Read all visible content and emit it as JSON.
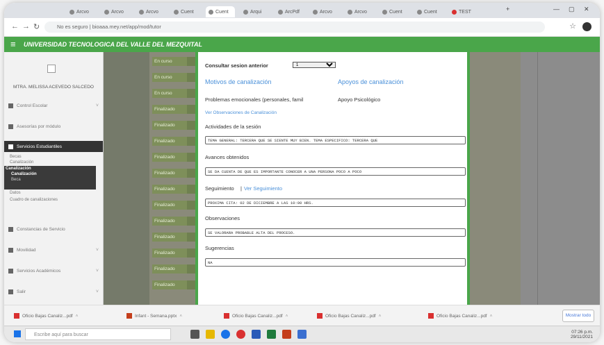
{
  "browser": {
    "tabs": [
      "Arcvo",
      "Arcvo",
      "Arcvo",
      "Cuent",
      "Cuent",
      "Arqui",
      "ArcPdf",
      "Arcvo",
      "Arcvo",
      "Cuent",
      "Cuent",
      "TEST"
    ],
    "active_tab": "4",
    "url": "No es seguro | bioaaa.mey.net/app/mod/tutor"
  },
  "app": {
    "title": "UNIVERSIDAD TECNOLOGICA DEL VALLE DEL MEZQUITAL"
  },
  "sidebar": {
    "user_name": "MTRA. MELISSA ACEVEDO SALCEDO",
    "items": [
      {
        "label": "Control Escolar",
        "icon": "book-icon"
      },
      {
        "label": "Asesorías por módulo",
        "icon": "grid-icon"
      },
      {
        "label": "Servicios Estudiantiles",
        "icon": "users-icon"
      },
      {
        "label": "Constancias de Servicio",
        "icon": "monitor-icon"
      },
      {
        "label": "Movilidad",
        "icon": "chart-icon"
      },
      {
        "label": "Servicios Académicos",
        "icon": "settings-icon"
      },
      {
        "label": "Salir",
        "icon": "exit-icon"
      }
    ],
    "subitems": [
      "Becas",
      "Canalización"
    ],
    "highlight_lines": [
      "Canalización",
      "Canalización",
      "Beca",
      "Datos",
      "Cuadro de canalizaciones"
    ]
  },
  "background_rows": [
    "En curso",
    "En curso",
    "En curso",
    "Finalizado",
    "Finalizado",
    "Finalizado",
    "Finalizado",
    "Finalizado",
    "Finalizado",
    "Finalizado",
    "Finalizado",
    "Finalizado",
    "Finalizado",
    "Finalizado",
    "Finalizado"
  ],
  "modal": {
    "consult_label": "Consultar sesion anterior",
    "consult_value": "1",
    "motivos_header": "Motivos de canalización",
    "apoyos_header": "Apoyos de canalización",
    "motivo_value": "Problemas emocionales (personales, famil",
    "apoyo_value": "Apoyo Psicológico",
    "ver_observaciones": "Ver Observaciones de Canalización",
    "actividades_label": "Actividades de la sesión",
    "actividades_value": "TEMA GENERAL: TERCERA QUE SE SIENTE MUY BIEN. TEMA ESPECIFICO: TERCERA QUE",
    "avances_label": "Avances obtenidos",
    "avances_value": "SE DA CUENTA DE QUE ES IMPORTANTE CONOCER A UNA PERSONA POCO A POCO",
    "seguimiento_label": "Seguimiento",
    "ver_seguimiento": "Ver Seguimiento",
    "seguimiento_value": "PROXIMA CITA: 02 DE DICIEMBRE A LAS 10:00 HRS.",
    "observaciones_label": "Observaciones",
    "observaciones_value": "SE VALORARA PROBABLE ALTA DEL PROCESO.",
    "sugerencias_label": "Sugerencias",
    "sugerencias_value": "NA"
  },
  "downloads": {
    "items": [
      "Oficio Bajas Canaliz...pdf",
      "Infant - Semana.pptx",
      "Oficio Bajas Canaliz...pdf",
      "Oficio Bajas Canaliz...pdf",
      "Oficio Bajas Canaliz...pdf"
    ],
    "show_all": "Mostrar todo"
  },
  "windows": {
    "search_placeholder": "Escribe aquí para buscar",
    "time": "07:26 p.m.",
    "date": "29/11/2021"
  }
}
